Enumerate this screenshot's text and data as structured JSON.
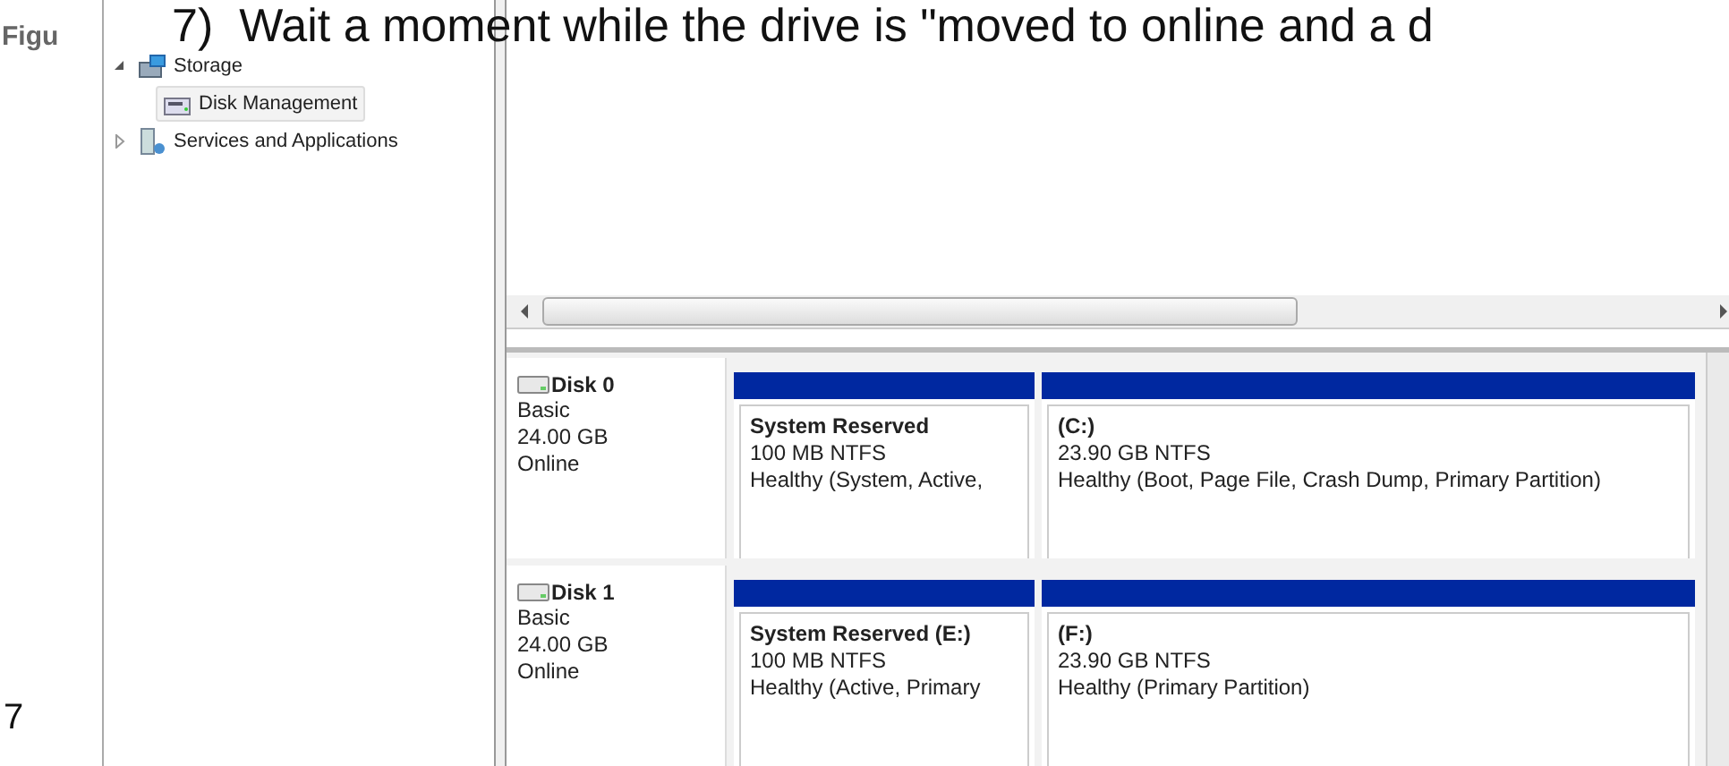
{
  "heading": "7)  Wait a moment while the drive is \"moved to online and a d",
  "caption": "Figu",
  "page_number": "7",
  "tree": [
    {
      "label": "Storage",
      "expanded": true,
      "selected": false,
      "children": [
        {
          "label": "Disk Management",
          "selected": true
        }
      ]
    },
    {
      "label": "Services and Applications",
      "expanded": false,
      "selected": false
    }
  ],
  "disks": [
    {
      "name": "Disk 0",
      "type": "Basic",
      "size": "24.00 GB",
      "status": "Online",
      "partitions": [
        {
          "name": "System Reserved",
          "size": "100 MB NTFS",
          "status": "Healthy (System, Active,"
        },
        {
          "name": "(C:)",
          "size": "23.90 GB NTFS",
          "status": "Healthy (Boot, Page File, Crash Dump, Primary Partition)"
        }
      ]
    },
    {
      "name": "Disk 1",
      "type": "Basic",
      "size": "24.00 GB",
      "status": "Online",
      "partitions": [
        {
          "name": "System Reserved  (E:)",
          "size": "100 MB NTFS",
          "status": "Healthy (Active, Primary"
        },
        {
          "name": "(F:)",
          "size": "23.90 GB NTFS",
          "status": "Healthy (Primary Partition)"
        }
      ]
    }
  ]
}
